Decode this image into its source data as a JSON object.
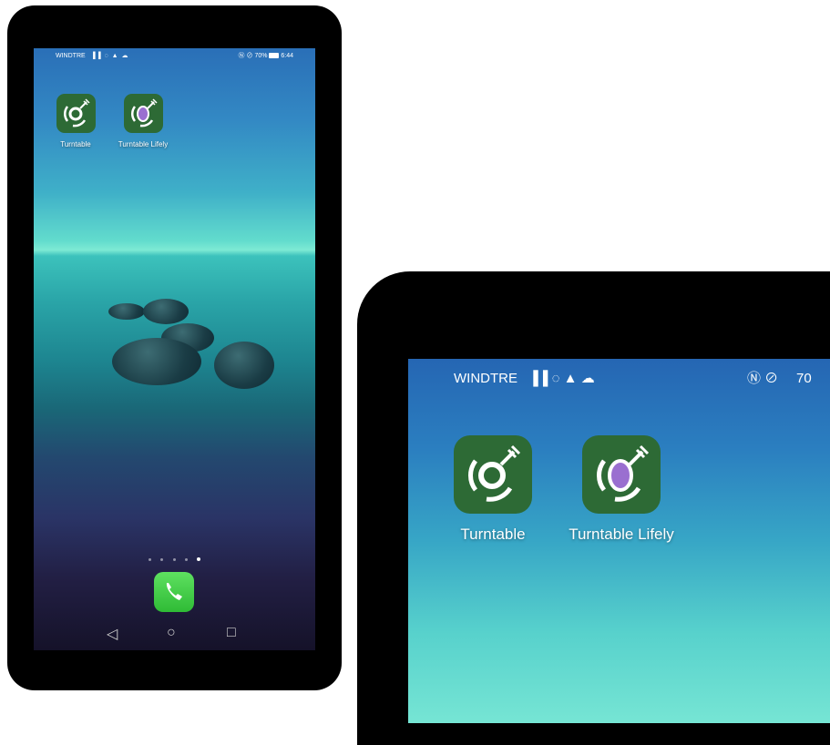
{
  "status_bar": {
    "carrier": "WINDTRE",
    "signal_icons": "▐▐ ◌ ▲ ☁",
    "battery": "70%",
    "time": "6:44",
    "right_icons": "Ⓝ ⊘"
  },
  "apps": [
    {
      "label": "Turntable",
      "icon": "turntable-icon"
    },
    {
      "label": "Turntable Lifely",
      "icon": "turntable-lifely-icon"
    }
  ],
  "zoom_status_bar": {
    "carrier": "WINDTRE",
    "right_text": "70"
  },
  "page_indicator": {
    "pages": 5,
    "active_index": 4
  },
  "dock": {
    "app": "phone-icon"
  },
  "navigation": {
    "back": "◁",
    "home": "○",
    "recents": "□"
  },
  "colors": {
    "app_icon_bg": "#2d6a35",
    "phone_app": "#3fcf44"
  }
}
